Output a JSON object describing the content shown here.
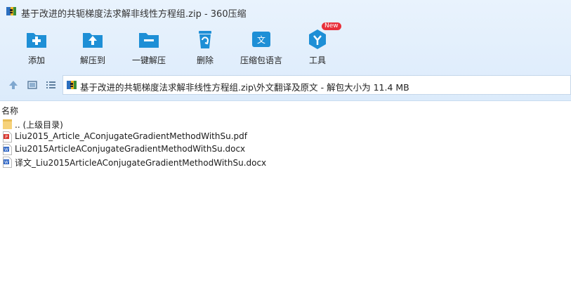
{
  "window": {
    "title": "基于改进的共轭梯度法求解非线性方程组.zip - 360压缩"
  },
  "toolbar": {
    "items": [
      {
        "label": "添加",
        "icon": "add-icon"
      },
      {
        "label": "解压到",
        "icon": "extract-to-icon"
      },
      {
        "label": "一键解压",
        "icon": "one-click-extract-icon"
      },
      {
        "label": "删除",
        "icon": "delete-icon"
      },
      {
        "label": "压缩包语言",
        "icon": "archive-language-icon"
      },
      {
        "label": "工具",
        "icon": "tools-icon",
        "badge": "New"
      }
    ]
  },
  "address": {
    "path": "基于改进的共轭梯度法求解非线性方程组.zip\\外文翻译及原文 - 解包大小为 11.4 MB"
  },
  "list": {
    "header_name": "名称",
    "rows": [
      {
        "name": ".. (上级目录)",
        "type": "folder"
      },
      {
        "name": "Liu2015_Article_AConjugateGradientMethodWithSu.pdf",
        "type": "pdf"
      },
      {
        "name": "Liu2015ArticleAConjugateGradientMethodWithSu.docx",
        "type": "docx"
      },
      {
        "name": "译文_Liu2015ArticleAConjugateGradientMethodWithSu.docx",
        "type": "docx"
      }
    ]
  },
  "colors": {
    "accent": "#1e8fd6",
    "toolbar_bg": "#e4f0fc",
    "badge": "#e8303a"
  }
}
